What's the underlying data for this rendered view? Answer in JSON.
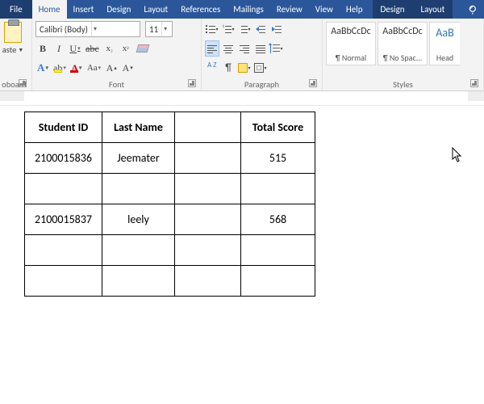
{
  "tabs": {
    "file": "File",
    "home": "Home",
    "insert": "Insert",
    "design": "Design",
    "layout": "Layout",
    "references": "References",
    "mailings": "Mailings",
    "review": "Review",
    "view": "View",
    "help": "Help",
    "ctx_design": "Design",
    "ctx_layout": "Layout"
  },
  "clipboard": {
    "paste": "aste",
    "group": "oboard"
  },
  "font": {
    "name": "Calibri (Body)",
    "size": "11",
    "bold": "B",
    "italic": "I",
    "underline": "U",
    "strike": "abc",
    "sub": "x",
    "sup": "x",
    "textfx": "A",
    "highlight": "ab",
    "fontcolor": "A",
    "charcase": "Aa",
    "grow": "A",
    "shrink": "A",
    "group": "Font"
  },
  "para": {
    "group": "Paragraph",
    "sort": "A\nZ"
  },
  "styles": {
    "group": "Styles",
    "preview": "AaBbCcDc",
    "preview_h": "AaB",
    "s1": "¶ Normal",
    "s2": "¶ No Spac...",
    "s3": "Head"
  },
  "table": {
    "headers": [
      "Student ID",
      "Last Name",
      "",
      "Total Score"
    ],
    "rows": [
      [
        "2100015836",
        "Jeemater",
        "",
        "515"
      ],
      [
        "",
        "",
        "",
        ""
      ],
      [
        "2100015837",
        "leely",
        "",
        "568"
      ],
      [
        "",
        "",
        "",
        ""
      ],
      [
        "",
        "",
        "",
        ""
      ]
    ]
  }
}
